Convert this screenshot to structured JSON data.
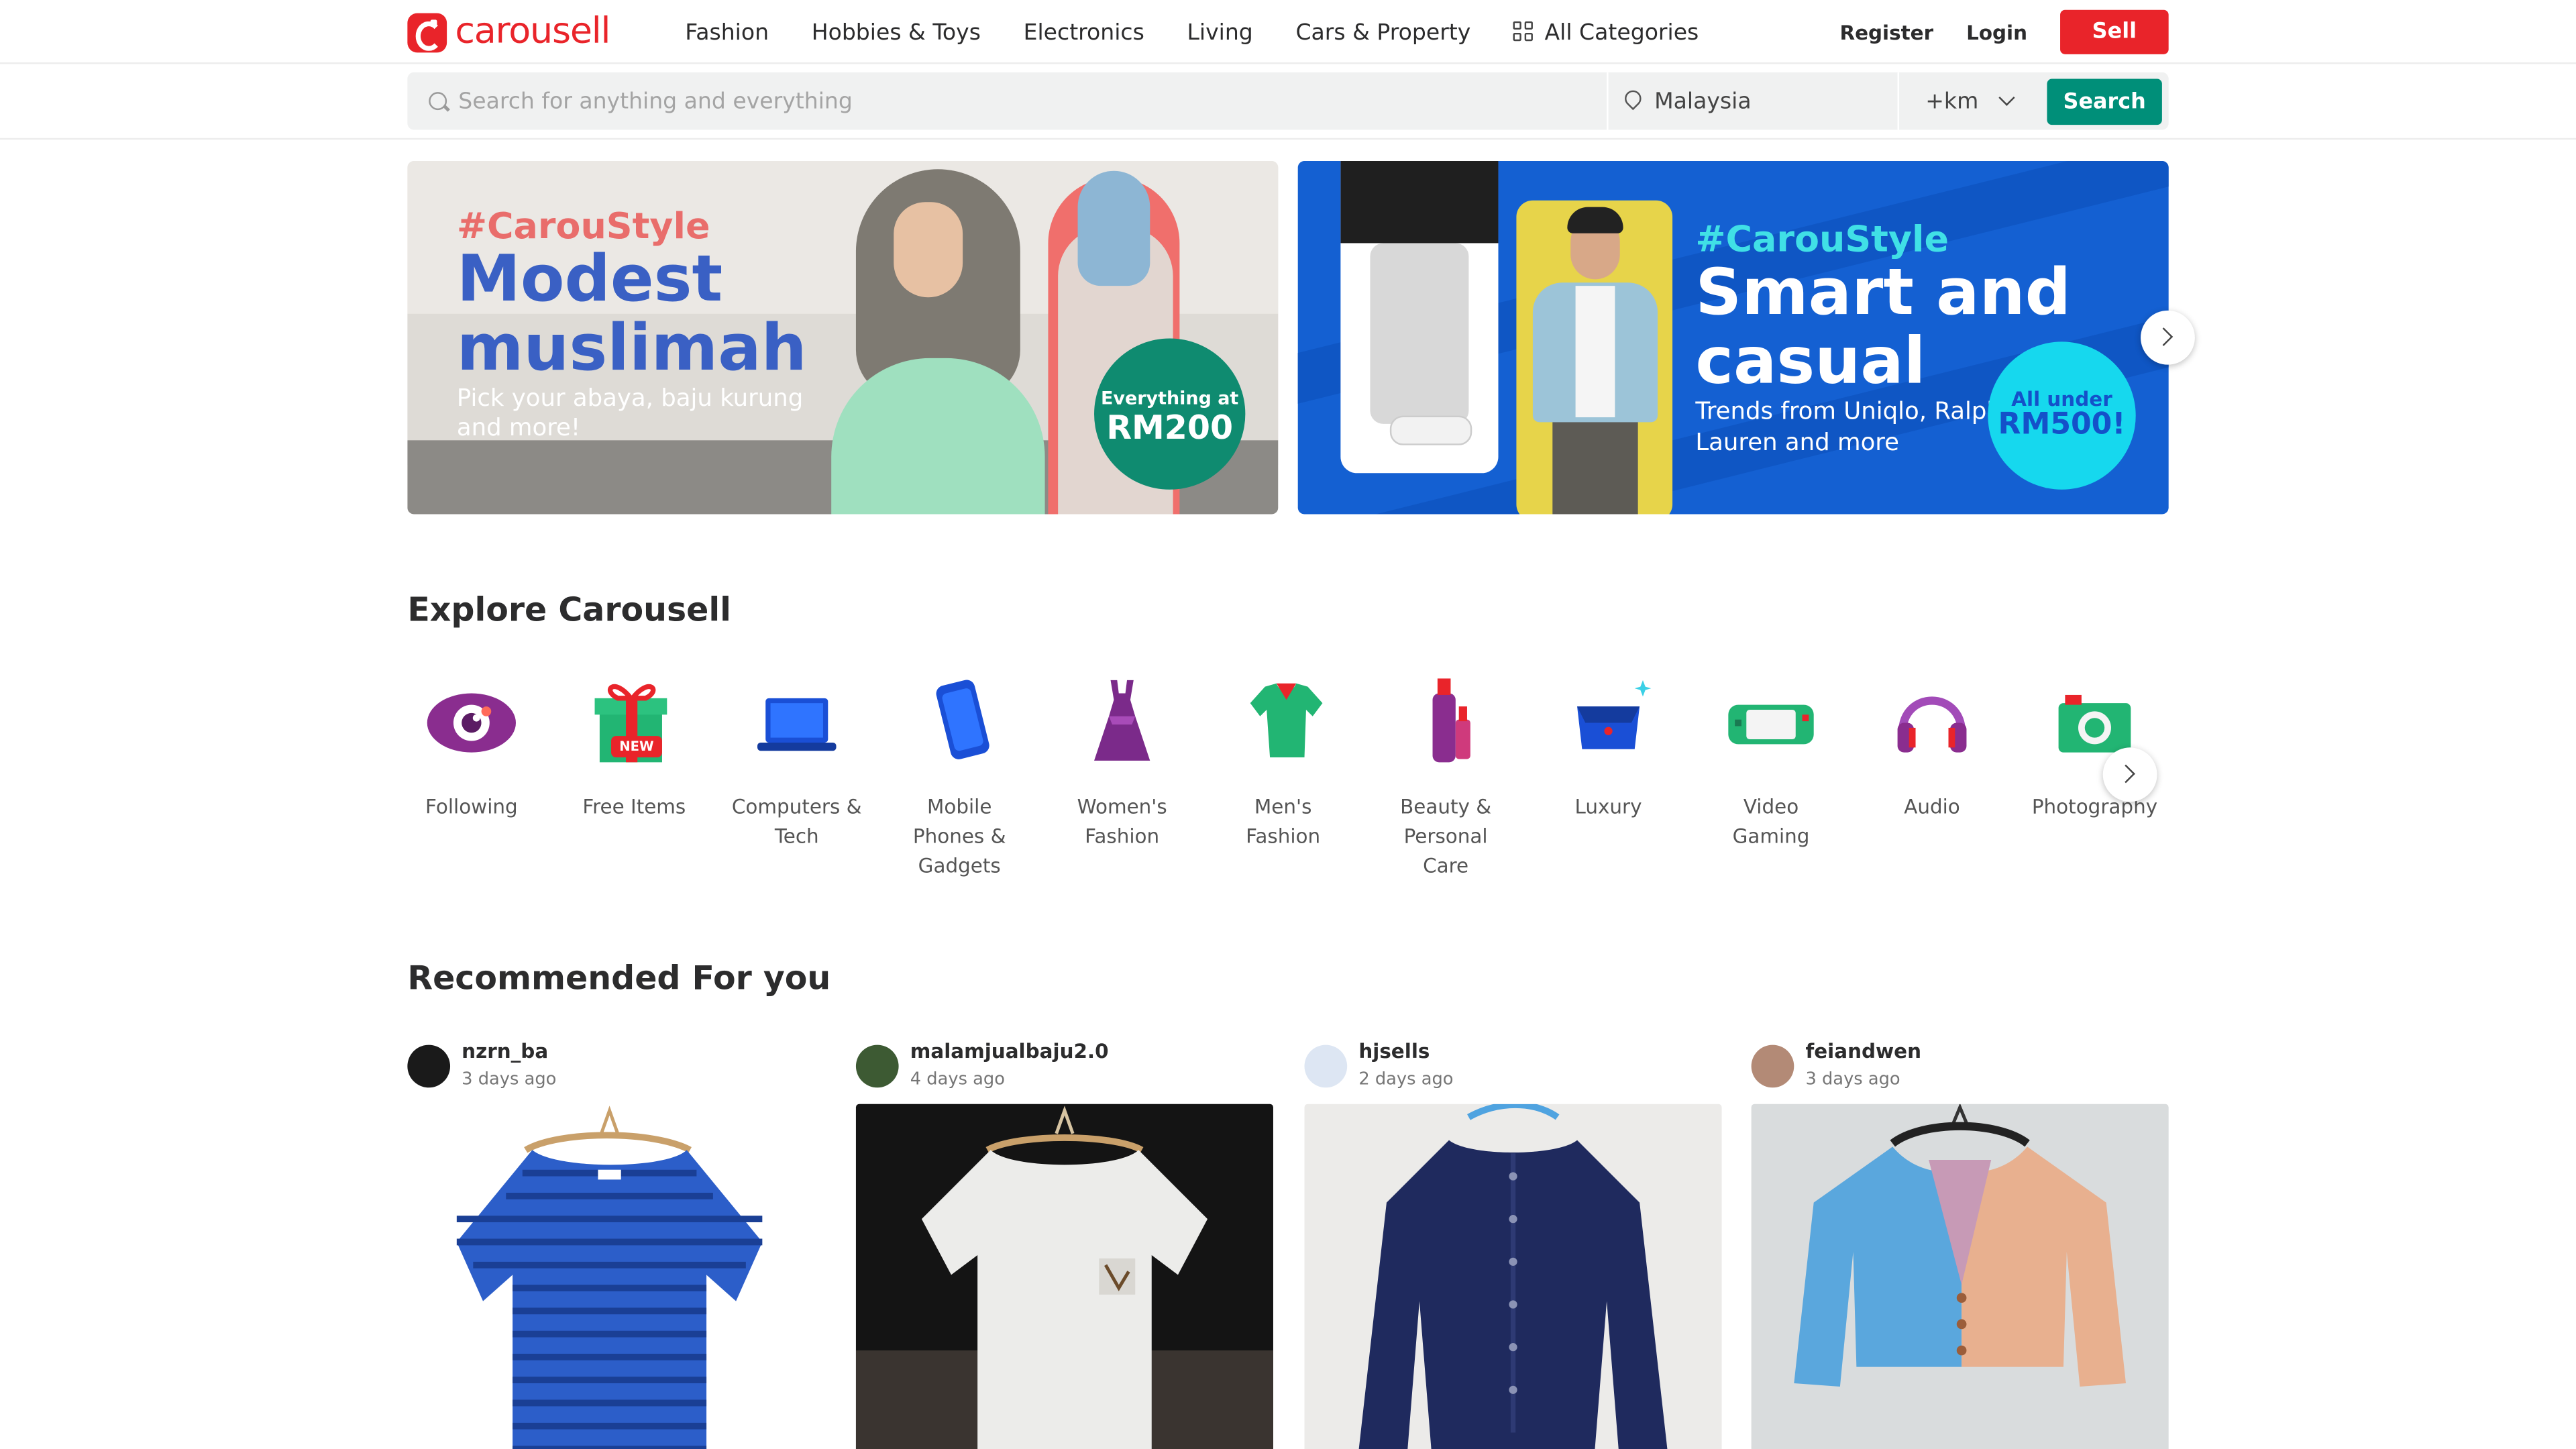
{
  "header": {
    "logo_text": "carousell",
    "nav": [
      "Fashion",
      "Hobbies & Toys",
      "Electronics",
      "Living",
      "Cars & Property"
    ],
    "all_categories": "All Categories",
    "register": "Register",
    "login": "Login",
    "sell": "Sell"
  },
  "search": {
    "placeholder": "Search for anything and everything",
    "location": "Malaysia",
    "distance": "+km",
    "button": "Search"
  },
  "banners": [
    {
      "tag": "#CarouStyle",
      "headline": "Modest muslimah",
      "subtitle": "Pick your abaya, baju kurung and more!",
      "badge_small": "Everything at",
      "badge_big": "RM200"
    },
    {
      "tag": "#CarouStyle",
      "headline": "Smart and casual",
      "subtitle": "Trends from Uniqlo, Ralph Lauren and more",
      "badge_small": "All under",
      "badge_big": "RM500!"
    }
  ],
  "explore": {
    "title": "Explore Carousell",
    "new_badge": "NEW",
    "categories": [
      {
        "label": "Following",
        "icon": "eye-icon"
      },
      {
        "label": "Free Items",
        "icon": "gift-icon"
      },
      {
        "label": "Computers & Tech",
        "icon": "laptop-icon"
      },
      {
        "label": "Mobile Phones & Gadgets",
        "icon": "phone-icon"
      },
      {
        "label": "Women's Fashion",
        "icon": "dress-icon"
      },
      {
        "label": "Men's Fashion",
        "icon": "shirt-icon"
      },
      {
        "label": "Beauty & Personal Care",
        "icon": "cosmetics-icon"
      },
      {
        "label": "Luxury",
        "icon": "handbag-icon"
      },
      {
        "label": "Video Gaming",
        "icon": "game-console-icon"
      },
      {
        "label": "Audio",
        "icon": "headphones-icon"
      },
      {
        "label": "Photography",
        "icon": "camera-icon"
      }
    ]
  },
  "recommended": {
    "title": "Recommended For you",
    "items": [
      {
        "user": "nzrn_ba",
        "age": "3 days ago",
        "avatar_color": "#1a1a1a"
      },
      {
        "user": "malamjualbaju2.0",
        "age": "4 days ago",
        "avatar_color": "#3d5a33"
      },
      {
        "user": "hjsells",
        "age": "2 days ago",
        "avatar_color": "#dde6f3"
      },
      {
        "user": "feiandwen",
        "age": "3 days ago",
        "avatar_color": "#b38a76"
      }
    ]
  },
  "colors": {
    "brand": "#e9242a",
    "search_green": "#008f79"
  }
}
